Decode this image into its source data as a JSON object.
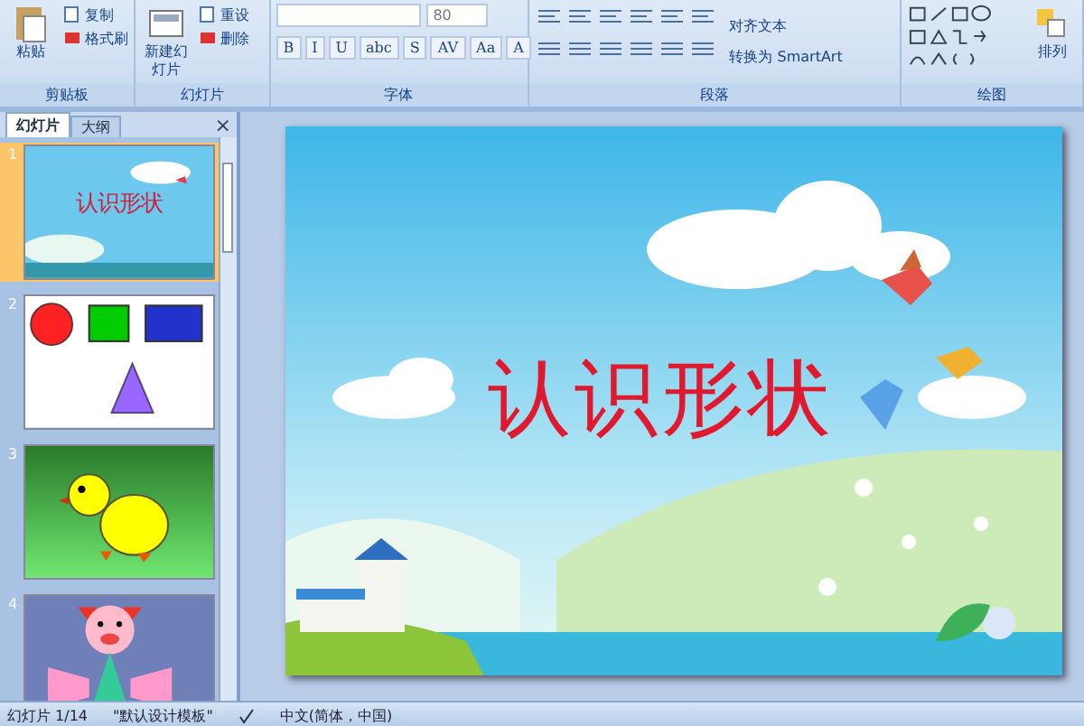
{
  "ribbon": {
    "groups": [
      {
        "label": "剪贴板",
        "kind": "clipboard",
        "large": "粘贴",
        "small": [
          "复制",
          "格式刷"
        ]
      },
      {
        "label": "幻灯片",
        "kind": "slides",
        "large": "新建幻灯片",
        "small": [
          "重设",
          "删除"
        ]
      },
      {
        "label": "字体",
        "kind": "font",
        "size": "80",
        "buttons": [
          "B",
          "I",
          "U",
          "abc",
          "S",
          "AV",
          "Aa",
          "A"
        ]
      },
      {
        "label": "段落",
        "kind": "paragraph",
        "small": [
          "对齐文本",
          "转换为 SmartArt"
        ]
      },
      {
        "label": "绘图",
        "kind": "drawing",
        "large": "排列"
      }
    ]
  },
  "panel": {
    "tabs": [
      {
        "label": "幻灯片",
        "selected": true
      },
      {
        "label": "大纲",
        "selected": false
      }
    ],
    "close": "×",
    "slides": [
      {
        "number": "1",
        "kind": "title",
        "title": "认识形状",
        "selected": true
      },
      {
        "number": "2",
        "kind": "shapes",
        "selected": false
      },
      {
        "number": "3",
        "kind": "chick",
        "selected": false
      },
      {
        "number": "4",
        "kind": "pig",
        "selected": false
      }
    ]
  },
  "slide": {
    "title": "认识形状"
  },
  "status_bar": {
    "slide": "幻灯片 1/14",
    "theme": "\"默认设计模板\"",
    "language": "中文(简体，中国)"
  }
}
